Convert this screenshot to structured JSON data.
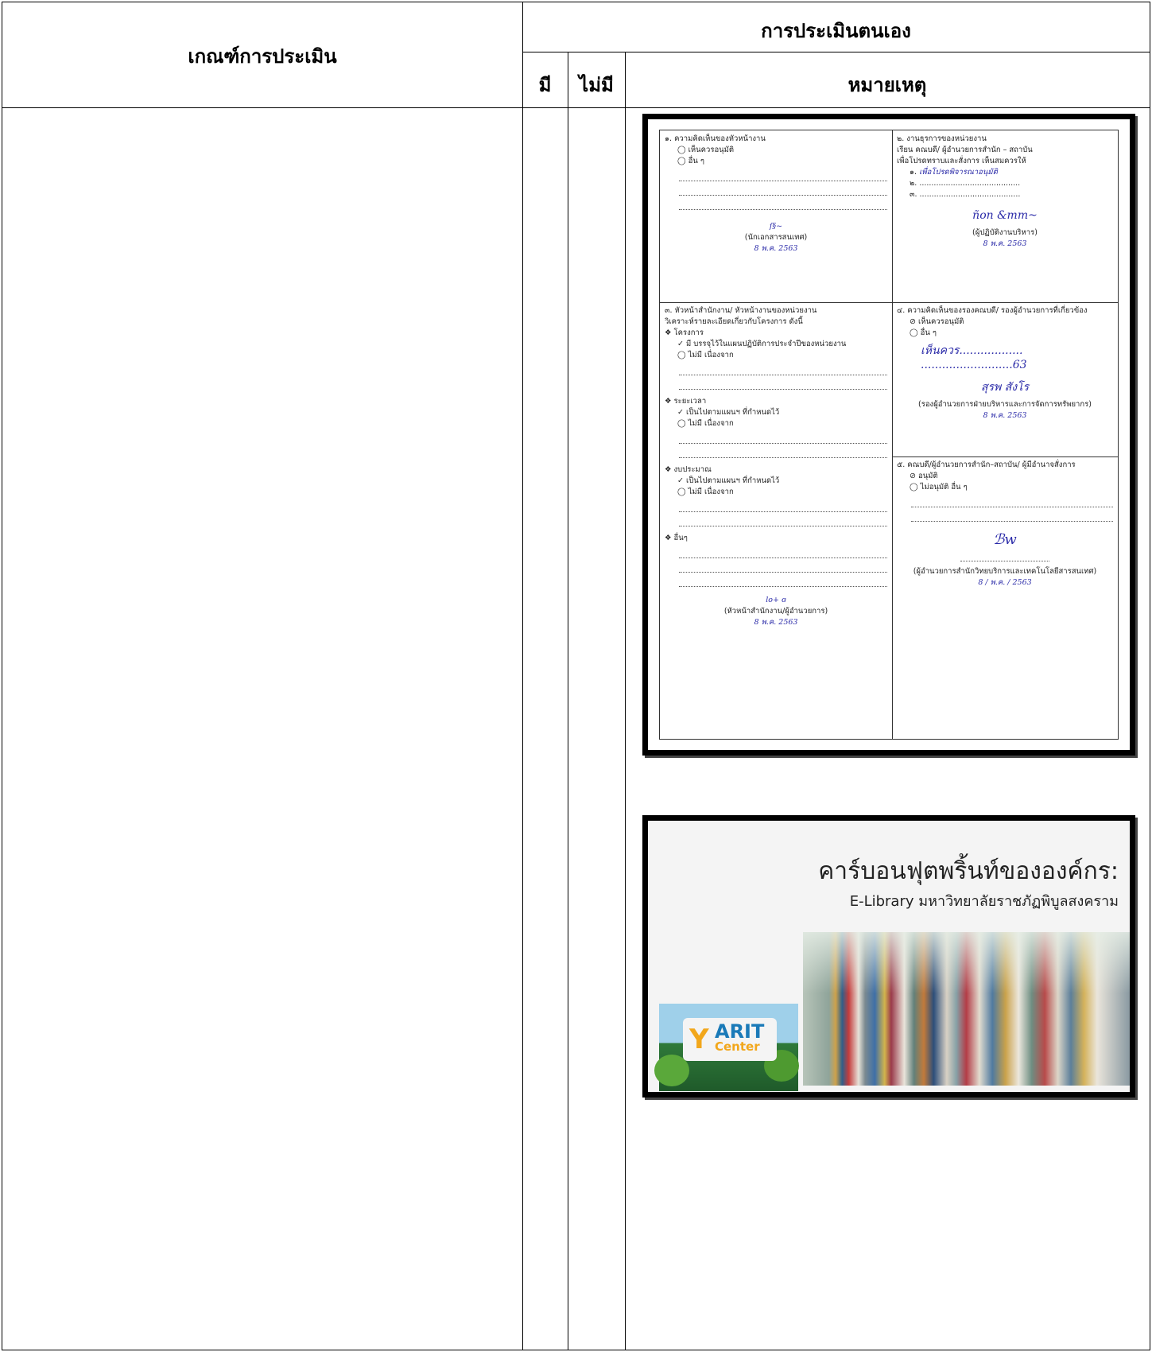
{
  "table": {
    "col_criteria": "เกณฑ์การประเมิน",
    "col_self_assessment": "การประเมินตนเอง",
    "col_yes": "มี",
    "col_no": "ไม่มี",
    "col_remark": "หมายเหตุ"
  },
  "form": {
    "s1_title": "๑. ความคิดเห็นของหัวหน้างาน",
    "s1_opt1": "เห็นควรอนุมัติ",
    "s1_opt2": "อื่น ๆ",
    "s1_sign": "(นักเอกสารสนเทศ)",
    "s1_date": "8 พ.ค. 2563",
    "s2_title": "๒. งานธุรการของหน่วยงาน",
    "s2_line1": "เรียน คณบดี/ ผู้อำนวยการสำนัก – สถาบัน",
    "s2_line2": "เพื่อโปรดทราบและสั่งการ เห็นสมควรให้",
    "s2_item1": "๑.",
    "s2_item1_hand": "เพื่อโปรดพิจารณาอนุมัติ",
    "s2_item2": "๒.",
    "s2_item3": "๓.",
    "s2_sign": "(ผู้ปฏิบัติงานบริหาร)",
    "s2_date": "8 พ.ค. 2563",
    "s3_title": "๓. หัวหน้าสำนักงาน/ หัวหน้างานของหน่วยงาน",
    "s3_line1": "วิเคราะห์รายละเอียดเกี่ยวกับโครงการ ดังนี้",
    "s3_project": "❖ โครงการ",
    "s3_project_opt1": "มี บรรจุไว้ในแผนปฏิบัติการประจำปีของหน่วยงาน",
    "s3_project_opt2": "ไม่มี เนื่องจาก",
    "s3_period": "❖ ระยะเวลา",
    "s3_period_opt1": "เป็นไปตามแผนฯ ที่กำหนดไว้",
    "s3_period_opt2": "ไม่มี เนื่องจาก",
    "s3_budget": "❖ งบประมาณ",
    "s3_budget_opt1": "เป็นไปตามแผนฯ ที่กำหนดไว้",
    "s3_budget_opt2": "ไม่มี เนื่องจาก",
    "s3_other": "❖ อื่นๆ",
    "s3_sign": "(หัวหน้าสำนักงาน/ผู้อำนวยการ)",
    "s3_date": "8 พ.ค. 2563",
    "s4_title": "๔. ความคิดเห็นของรองคณบดี/ รองผู้อำนวยการที่เกี่ยวข้อง",
    "s4_opt1": "เห็นควรอนุมัติ",
    "s4_opt2": "อื่น ๆ",
    "s4_sign": "(รองผู้อำนวยการฝ่ายบริหารและการจัดการทรัพยากร)",
    "s4_date": "8 พ.ค. 2563",
    "s5_title": "๕. คณบดี/ผู้อำนวยการสำนัก–สถาบัน/ ผู้มีอำนาจสั่งการ",
    "s5_opt1": "อนุมัติ",
    "s5_opt2": "ไม่อนุมัติ อื่น ๆ",
    "s5_sign": "(ผู้อำนวยการสำนักวิทยบริการและเทคโนโลยีสารสนเทศ)",
    "s5_date": "8 / พ.ค. / 2563"
  },
  "banner": {
    "title": "คาร์บอนฟุตพริ้นท์ขององค์กร:",
    "subtitle": "E-Library มหาวิทยาลัยราชภัฏพิบูลสงคราม",
    "logo_text1": "ARIT",
    "logo_text2": "Center"
  }
}
